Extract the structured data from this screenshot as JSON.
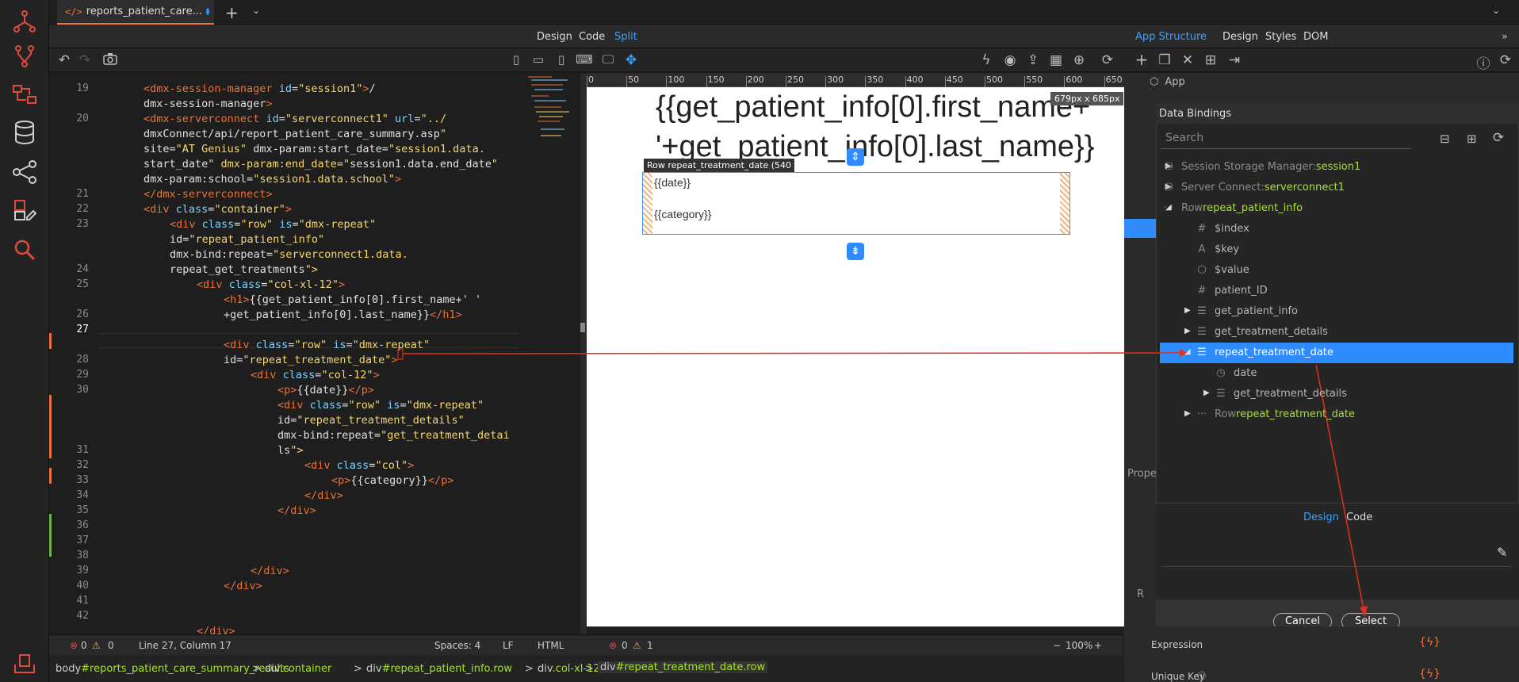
{
  "tab": {
    "title": "reports_patient_care..."
  },
  "modes": {
    "design": "Design",
    "code": "Code",
    "split": "Split"
  },
  "struct_tabs": {
    "app_structure": "App Structure",
    "design": "Design",
    "styles": "Styles",
    "dom": "DOM"
  },
  "app_tree_root": "App",
  "gutter_lines": [
    "19",
    "",
    "20",
    "",
    "",
    "",
    "",
    "21",
    "22",
    "23",
    "",
    "",
    "24",
    "25",
    "",
    "26",
    "27",
    "",
    "28",
    "29",
    "30",
    "",
    "",
    "",
    "31",
    "32",
    "33",
    "34",
    "35",
    "36",
    "37",
    "38",
    "39",
    "40",
    "41",
    "42"
  ],
  "code_lines": [
    "<dmx-session-manager id=\"session1\"></",
    "dmx-session-manager>",
    "<dmx-serverconnect id=\"serverconnect1\" url=\"../",
    "dmxConnect/api/report_patient_care_summary.asp\"",
    "site=\"AT Genius\" dmx-param:start_date=\"session1.data.",
    "start_date\" dmx-param:end_date=\"session1.data.end_date\"",
    "dmx-param:school=\"session1.data.school\">",
    "</dmx-serverconnect>",
    "<div class=\"container\">",
    "<div class=\"row\" is=\"dmx-repeat\"",
    "id=\"repeat_patient_info\"",
    "dmx-bind:repeat=\"serverconnect1.data.",
    "repeat_get_treatments\">",
    "<div class=\"col-xl-12\">",
    "<h1>{{get_patient_info[0].first_name+' '",
    "+get_patient_info[0].last_name}}</h1>",
    "",
    "<div class=\"row\" is=\"dmx-repeat\"",
    "id=\"repeat_treatment_date\">",
    "<div class=\"col-12\">",
    "<p>{{date}}</p>",
    "<div class=\"row\" is=\"dmx-repeat\"",
    "id=\"repeat_treatment_details\"",
    "dmx-bind:repeat=\"get_treatment_detai",
    "ls\">",
    "<div class=\"col\">",
    "<p>{{category}}</p>",
    "</div>",
    "</div>",
    "",
    "",
    "",
    "</div>",
    "</div>",
    "",
    "",
    "</div>"
  ],
  "ruler_ticks": [
    "0",
    "50",
    "100",
    "150",
    "200",
    "250",
    "300",
    "350",
    "400",
    "450",
    "500",
    "550",
    "600",
    "650"
  ],
  "size_badge": "679px x 685px",
  "preview": {
    "heading_line1": "{{get_patient_info[0].first_name+",
    "heading_line2": "'+get_patient_info[0].last_name}}",
    "row_label": "Row repeat_treatment_date (540",
    "date_text": "{{date}}",
    "category_text": "{{category}}"
  },
  "data_bindings": {
    "title": "Data Bindings",
    "search_placeholder": "Search",
    "items": [
      {
        "prefix": "Session Storage Manager: ",
        "name": "session1"
      },
      {
        "prefix": "Server Connect: ",
        "name": "serverconnect1"
      },
      {
        "prefix": "Row ",
        "name": "repeat_patient_info"
      },
      {
        "name": "$index"
      },
      {
        "name": "$key"
      },
      {
        "name": "$value"
      },
      {
        "name": "patient_ID"
      },
      {
        "name": "get_patient_info"
      },
      {
        "name": "get_treatment_details"
      },
      {
        "name": "repeat_treatment_date"
      },
      {
        "name": "date"
      },
      {
        "name": "get_treatment_details"
      },
      {
        "prefix": "Row ",
        "name": "repeat_treatment_date"
      }
    ],
    "design_tab": "Design",
    "code_tab": "Code",
    "cancel": "Cancel",
    "select": "Select"
  },
  "properties": {
    "label": "Prope",
    "expression": "Expression",
    "unique_key": "Unique Key",
    "r_label": "R"
  },
  "status": {
    "errors_left": "0",
    "warnings_left": "0",
    "position": "Line 27, Column 17",
    "spaces": "Spaces: 4",
    "eol": "LF",
    "lang": "HTML",
    "errors_right": "0",
    "warnings_right": "1",
    "zoom": "100%"
  },
  "breadcrumb": [
    {
      "tag": "body",
      "id": "#reports_patient_care_summary_results"
    },
    {
      "tag": "div",
      "id": ".container"
    },
    {
      "tag": "div",
      "id": "#repeat_patient_info.row"
    },
    {
      "tag": "div",
      "id": ".col-xl-12"
    },
    {
      "tag": "div",
      "id": "#repeat_treatment_date.row"
    }
  ],
  "colors": {
    "accent": "#2f8cff",
    "tag": "#e8733a",
    "attr": "#7fd4ff",
    "value": "#f5d76e",
    "binding": "#a6e22e",
    "arrow": "#e0301e"
  }
}
